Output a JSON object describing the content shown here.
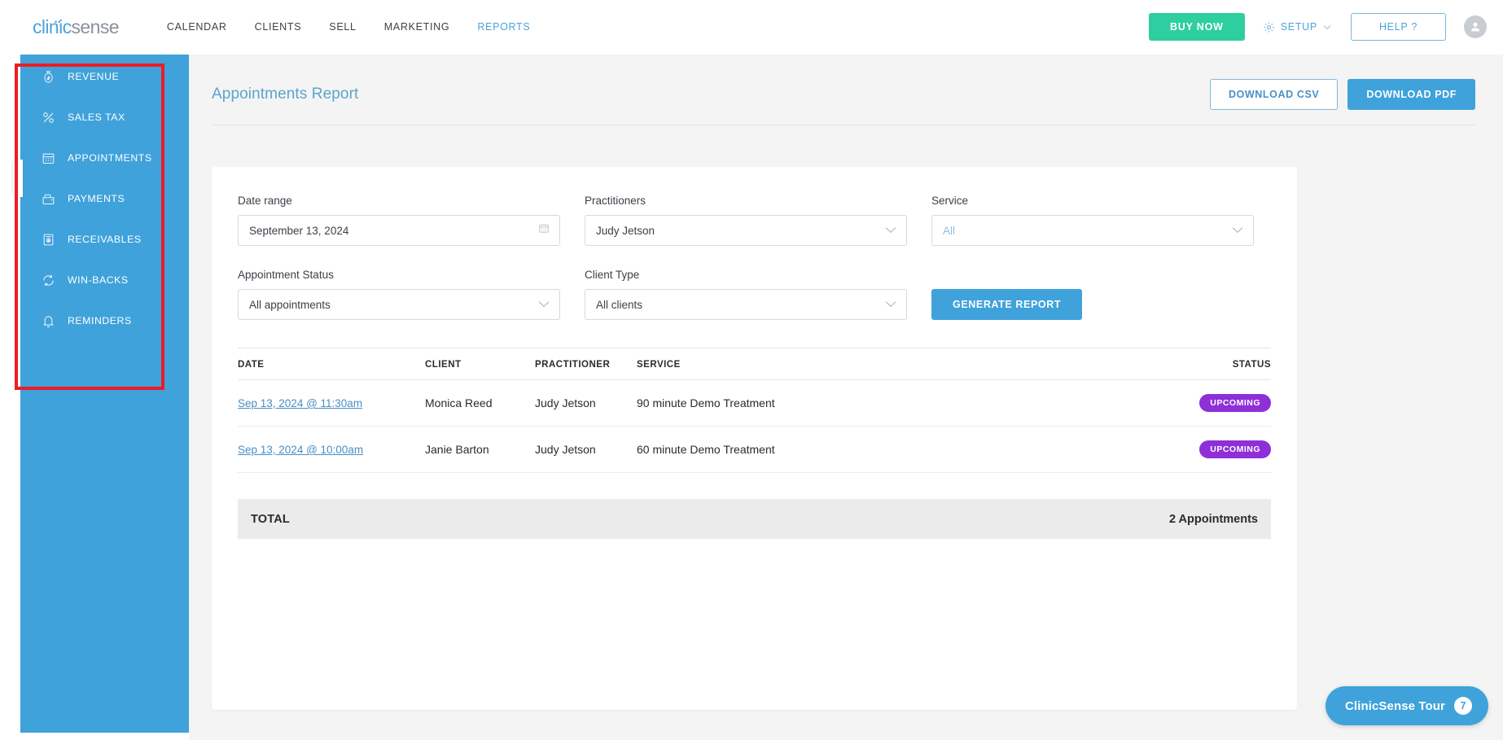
{
  "topnav": {
    "logo_part1": "clinic",
    "logo_part2": "sense",
    "links": [
      {
        "label": "CALENDAR",
        "active": false
      },
      {
        "label": "CLIENTS",
        "active": false
      },
      {
        "label": "SELL",
        "active": false
      },
      {
        "label": "MARKETING",
        "active": false
      },
      {
        "label": "REPORTS",
        "active": true
      }
    ],
    "buy_now": "BUY NOW",
    "setup": "SETUP",
    "help": "HELP ?",
    "accent_green": "#2ecea0",
    "accent_blue": "#4ca4da"
  },
  "sidebar": {
    "bg": "#3fa2db",
    "items": [
      {
        "label": "REVENUE",
        "icon": "money-bag-icon"
      },
      {
        "label": "SALES TAX",
        "icon": "percent-icon"
      },
      {
        "label": "APPOINTMENTS",
        "icon": "calendar-icon"
      },
      {
        "label": "PAYMENTS",
        "icon": "wallet-icon"
      },
      {
        "label": "RECEIVABLES",
        "icon": "receipt-icon"
      },
      {
        "label": "WIN-BACKS",
        "icon": "refresh-icon"
      },
      {
        "label": "REMINDERS",
        "icon": "bell-icon"
      }
    ],
    "highlight_color": "#ee1b24"
  },
  "page": {
    "title": "Appointments Report",
    "download_csv": "DOWNLOAD CSV",
    "download_pdf": "DOWNLOAD PDF"
  },
  "filters": {
    "date_range": {
      "label": "Date range",
      "value": "September 13, 2024"
    },
    "practitioners": {
      "label": "Practitioners",
      "value": "Judy Jetson"
    },
    "service": {
      "label": "Service",
      "value": "All",
      "is_placeholder": true
    },
    "appointment_status": {
      "label": "Appointment Status",
      "value": "All appointments"
    },
    "client_type": {
      "label": "Client Type",
      "value": "All clients"
    },
    "generate_button": "GENERATE REPORT"
  },
  "table": {
    "headers": {
      "date": "DATE",
      "client": "CLIENT",
      "practitioner": "PRACTITIONER",
      "service": "SERVICE",
      "status": "STATUS"
    },
    "rows": [
      {
        "date": "Sep 13, 2024 @ 11:30am",
        "client": "Monica Reed",
        "practitioner": "Judy Jetson",
        "service": "90 minute Demo Treatment",
        "status": "UPCOMING"
      },
      {
        "date": "Sep 13, 2024 @ 10:00am",
        "client": "Janie Barton",
        "practitioner": "Judy Jetson",
        "service": "60 minute Demo Treatment",
        "status": "UPCOMING"
      }
    ],
    "total_label": "TOTAL",
    "total_value": "2 Appointments",
    "badge_color": "#8e2fd8"
  },
  "tour": {
    "label": "ClinicSense Tour",
    "count": "7"
  }
}
